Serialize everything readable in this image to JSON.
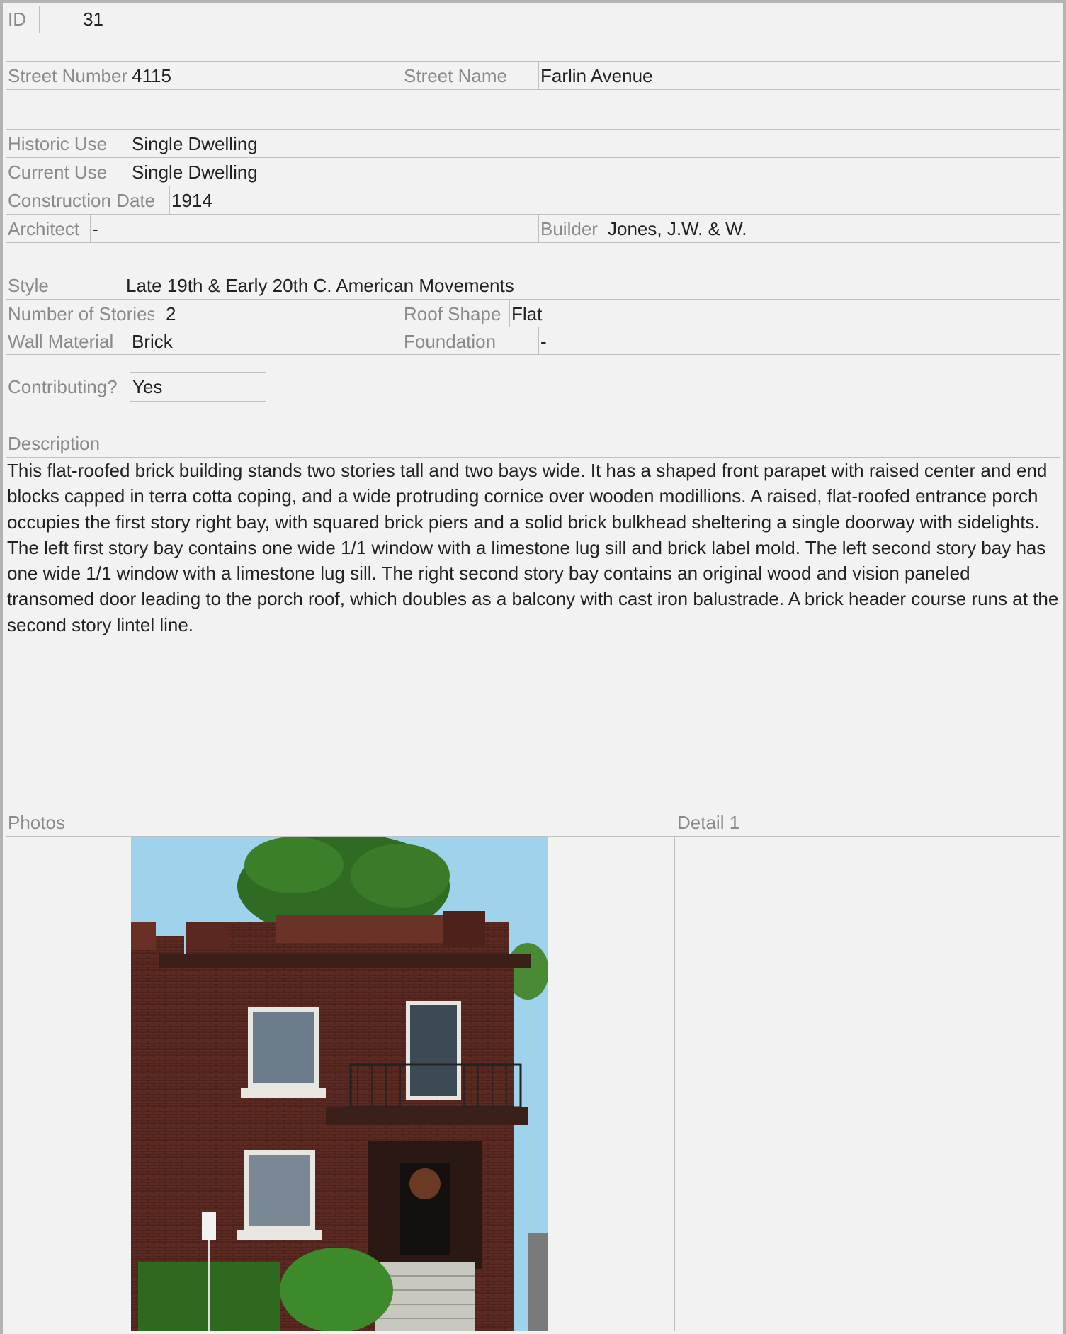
{
  "record": {
    "id_label": "ID",
    "id_value": "31",
    "street_number_label": "Street Number",
    "street_number_value": "4115",
    "street_name_label": "Street Name",
    "street_name_value": "Farlin Avenue",
    "historic_use_label": "Historic Use",
    "historic_use_value": "Single Dwelling",
    "current_use_label": "Current Use",
    "current_use_value": "Single Dwelling",
    "construction_date_label": "Construction Date",
    "construction_date_value": "1914",
    "architect_label": "Architect",
    "architect_value": "-",
    "builder_label": "Builder",
    "builder_value": "Jones, J.W. & W.",
    "style_label": "Style",
    "style_value": "Late 19th & Early 20th C. American Movements",
    "stories_label": "Number of Stories",
    "stories_value": "2",
    "roof_label": "Roof Shape",
    "roof_value": "Flat",
    "wall_label": "Wall Material",
    "wall_value": "Brick",
    "foundation_label": "Foundation",
    "foundation_value": "-",
    "contributing_label": "Contributing?",
    "contributing_value": "Yes",
    "description_label": "Description",
    "description_text": "This flat-roofed brick building stands two stories tall and two bays wide. It has a shaped front parapet with raised center and end blocks capped in terra cotta coping, and a wide protruding cornice over wooden modillions. A raised, flat-roofed entrance porch occupies the first story right bay, with squared brick piers and a solid brick bulkhead sheltering a single doorway with sidelights. The left first story bay contains one wide 1/1 window with a limestone lug sill and brick label mold. The left second story bay has one wide 1/1 window with a limestone lug sill. The right second story bay contains an original wood and vision paneled transomed door leading to the porch roof, which doubles as a balcony with cast iron balustrade. A brick header course runs at the second story lintel line.",
    "photos_label": "Photos",
    "detail_label": "Detail 1"
  }
}
